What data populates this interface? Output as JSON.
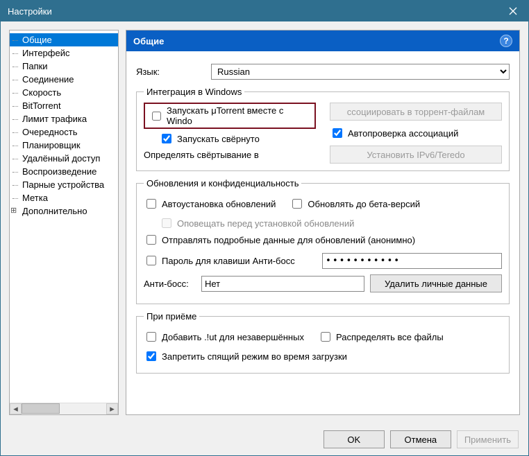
{
  "window": {
    "title": "Настройки"
  },
  "tree": {
    "items": [
      "Общие",
      "Интерфейс",
      "Папки",
      "Соединение",
      "Скорость",
      "BitTorrent",
      "Лимит трафика",
      "Очередность",
      "Планировщик",
      "Удалённый доступ",
      "Воспроизведение",
      "Парные устройства",
      "Метка",
      "Дополнительно"
    ],
    "selected_index": 0,
    "expandable_index": 13
  },
  "panel": {
    "title": "Общие",
    "language": {
      "label": "Язык:",
      "value": "Russian"
    },
    "integration": {
      "legend": "Интеграция в Windows",
      "start_with_windows": "Запускать μTorrent вместе с Windo",
      "associate_btn": "ссоциировать в торрент-файлам",
      "start_minimized": "Запускать свёрнуто",
      "autocheck_assoc": "Автопроверка ассоциаций",
      "minimize_to_label": "Определять свёртывание в",
      "ipv6_btn": "Установить IPv6/Teredo"
    },
    "updates": {
      "legend": "Обновления и конфиденциальность",
      "autoinstall": "Автоустановка обновлений",
      "beta": "Обновлять до бета-версий",
      "notify_before": "Оповещать перед установкой обновлений",
      "send_details": "Отправлять подробные данные для обновлений (анонимно)",
      "password_label": "Пароль для клавиши Анти-босс",
      "password_value": "•••••••••••",
      "antiboss_label": "Анти-босс:",
      "antiboss_value": "Нет",
      "clear_btn": "Удалить личные данные"
    },
    "download": {
      "legend": "При приёме",
      "add_ut": "Добавить .!ut для незавершённых",
      "preallocate": "Распределять все файлы",
      "prevent_sleep": "Запретить спящий режим во время загрузки"
    }
  },
  "footer": {
    "ok": "OK",
    "cancel": "Отмена",
    "apply": "Применить"
  }
}
